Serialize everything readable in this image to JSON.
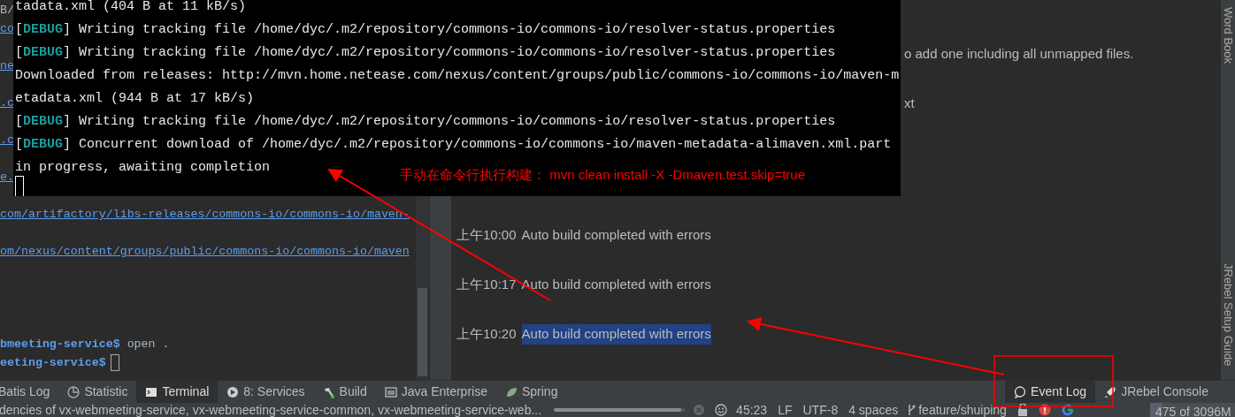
{
  "ide_terminal": {
    "lines": [
      {
        "segments": [
          {
            "kind": "plain",
            "text": "B/"
          }
        ]
      },
      {
        "segments": [
          {
            "kind": "link",
            "text": "co"
          }
        ]
      },
      {
        "segments": [
          {
            "kind": "link",
            "text": "ne"
          }
        ]
      },
      {
        "segments": [
          {
            "kind": "link",
            "text": ".c"
          }
        ]
      },
      {
        "segments": [
          {
            "kind": "link",
            "text": ".c"
          }
        ]
      },
      {
        "segments": [
          {
            "kind": "link",
            "text": "e."
          }
        ]
      },
      {
        "segments": [
          {
            "kind": "link",
            "text": "com/artifactory/libs-releases/commons-io/commons-io/maven-"
          }
        ]
      },
      {
        "segments": [
          {
            "kind": "link",
            "text": "om/nexus/content/groups/public/commons-io/commons-io/maven"
          }
        ]
      },
      {
        "segments": [
          {
            "kind": "prompt",
            "text": "bmeeting-service$"
          },
          {
            "kind": "plain",
            "text": " open ."
          }
        ]
      },
      {
        "segments": [
          {
            "kind": "prompt",
            "text": "eeting-service$"
          }
        ],
        "cursor": true
      }
    ]
  },
  "event_log": {
    "partial_lines": [
      "o add one including all unmapped files.",
      "xt"
    ],
    "entries": [
      {
        "time": "上午10:00",
        "message": "Auto build completed with errors",
        "selected": false
      },
      {
        "time": "上午10:17",
        "message": "Auto build completed with errors",
        "selected": false
      },
      {
        "time": "上午10:20",
        "message": "Auto build completed with errors",
        "selected": true
      }
    ]
  },
  "right_sidebar": {
    "top": "Word Book",
    "bottom": "JRebel Setup Guide"
  },
  "tool_tabs_left": [
    {
      "label": "Batis Log",
      "selected": false
    },
    {
      "label": "Statistic",
      "selected": false
    },
    {
      "label": "Terminal",
      "selected": true
    },
    {
      "label": "8: Services",
      "selected": false
    },
    {
      "label": "Build",
      "selected": false
    },
    {
      "label": "Java Enterprise",
      "selected": false
    },
    {
      "label": "Spring",
      "selected": false
    }
  ],
  "tool_tabs_right": [
    {
      "label": "Event Log",
      "selected": true
    },
    {
      "label": "JRebel Console",
      "selected": false
    }
  ],
  "status_bar": {
    "message": "dencies of vx-webmeeting-service, vx-webmeeting-service-common, vx-webmeeting-service-web...",
    "progress": {
      "level": 0.97
    },
    "position": "45:23",
    "line_separator": "LF",
    "encoding": "UTF-8",
    "indent": "4 spaces",
    "branch": "feature/shuiping",
    "memory": "475 of 3096M",
    "memory_usage": {
      "level": 0.15
    }
  },
  "terminal_window": {
    "lines": [
      {
        "segments": [
          {
            "kind": "plain",
            "text": "tadata.xml (404 B at 11 kB/s)"
          }
        ]
      },
      {
        "segments": [
          {
            "kind": "plain",
            "text": "["
          },
          {
            "kind": "tag",
            "text": "DEBUG"
          },
          {
            "kind": "plain",
            "text": "] Writing tracking file /home/dyc/.m2/repository/commons-io/commons-io/resolver-status.properties"
          }
        ]
      },
      {
        "segments": [
          {
            "kind": "plain",
            "text": "["
          },
          {
            "kind": "tag",
            "text": "DEBUG"
          },
          {
            "kind": "plain",
            "text": "] Writing tracking file /home/dyc/.m2/repository/commons-io/commons-io/resolver-status.properties"
          }
        ]
      },
      {
        "segments": [
          {
            "kind": "plain",
            "text": "Downloaded from releases: http://mvn.home.netease.com/nexus/content/groups/public/commons-io/commons-io/maven-m"
          }
        ]
      },
      {
        "segments": [
          {
            "kind": "plain",
            "text": "etadata.xml (944 B at 17 kB/s)"
          }
        ]
      },
      {
        "segments": [
          {
            "kind": "plain",
            "text": "["
          },
          {
            "kind": "tag",
            "text": "DEBUG"
          },
          {
            "kind": "plain",
            "text": "] Writing tracking file /home/dyc/.m2/repository/commons-io/commons-io/resolver-status.properties"
          }
        ]
      },
      {
        "segments": [
          {
            "kind": "plain",
            "text": "["
          },
          {
            "kind": "tag",
            "text": "DEBUG"
          },
          {
            "kind": "plain",
            "text": "] Concurrent download of /home/dyc/.m2/repository/commons-io/commons-io/maven-metadata-alimaven.xml.part"
          }
        ]
      },
      {
        "segments": [
          {
            "kind": "plain",
            "text": "in progress, awaiting completion"
          }
        ]
      }
    ],
    "cursor": true
  },
  "annotation": {
    "text": "手动在命令行执行构建：  mvn clean install -X -Dmaven.test.skip=true"
  }
}
